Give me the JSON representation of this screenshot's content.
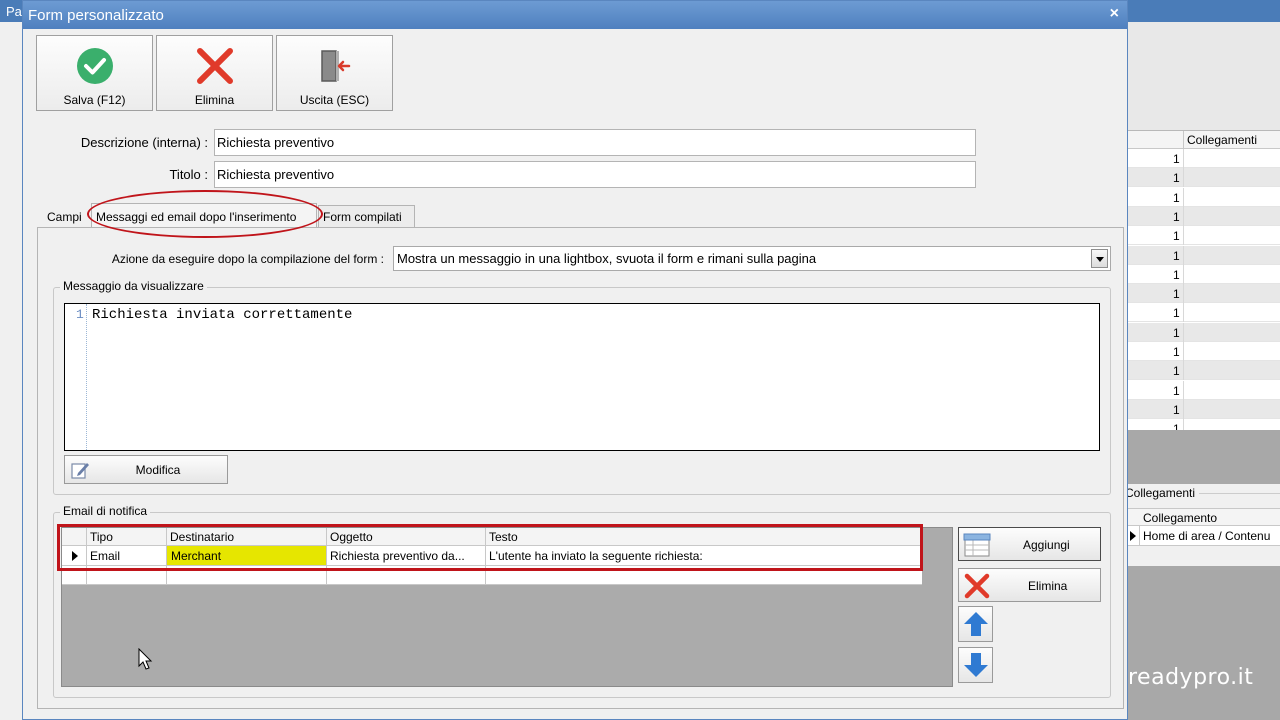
{
  "background_app": {
    "title": "Pa",
    "table_header": "Collegamenti",
    "table_values": [
      "1",
      "1",
      "1",
      "1",
      "1",
      "1",
      "1",
      "1",
      "1",
      "1",
      "1",
      "1",
      "1",
      "1",
      "1"
    ],
    "lower_group_label": "Collegamenti",
    "lower_grid_header": "Collegamento",
    "lower_grid_row": "Home di area / Contenu",
    "watermark": "readypro.it"
  },
  "dialog": {
    "title": "Form personalizzato",
    "close_label": "×"
  },
  "toolbar": {
    "save_label": "Salva (F12)",
    "delete_label": "Elimina",
    "exit_label": "Uscita (ESC)"
  },
  "form": {
    "description_label": "Descrizione (interna) :",
    "description_value": "Richiesta preventivo",
    "title_label": "Titolo :",
    "title_value": "Richiesta preventivo"
  },
  "tabs": [
    {
      "label": "Campi"
    },
    {
      "label": "Messaggi ed email dopo l'inserimento"
    },
    {
      "label": "Form compilati"
    }
  ],
  "action": {
    "label": "Azione da eseguire dopo la compilazione del form :",
    "selected": "Mostra un messaggio in una lightbox, svuota il form e rimani sulla pagina"
  },
  "message": {
    "group_label": "Messaggio da visualizzare",
    "line_number": "1",
    "text": "Richiesta inviata correttamente",
    "modify_label": "Modifica"
  },
  "notification": {
    "group_label": "Email di notifica",
    "columns": [
      "Tipo",
      "Destinatario",
      "Oggetto",
      "Testo"
    ],
    "rows": [
      [
        "Email",
        "Merchant",
        "Richiesta preventivo da...",
        "L'utente ha inviato la seguente richiesta:"
      ]
    ],
    "add_label": "Aggiungi",
    "delete_label": "Elimina"
  },
  "colors": {
    "accent_blue": "#4f80bf",
    "highlight_yellow": "#e6e600",
    "annotation_red": "#c0141a",
    "save_green": "#3aaf6c",
    "delete_red": "#e03a2a"
  },
  "icons": {
    "save": "check-circle-icon",
    "delete": "x-icon",
    "exit": "door-exit-icon",
    "modify": "edit-icon",
    "add": "add-row-icon",
    "up": "arrow-up-icon",
    "down": "arrow-down-icon"
  }
}
